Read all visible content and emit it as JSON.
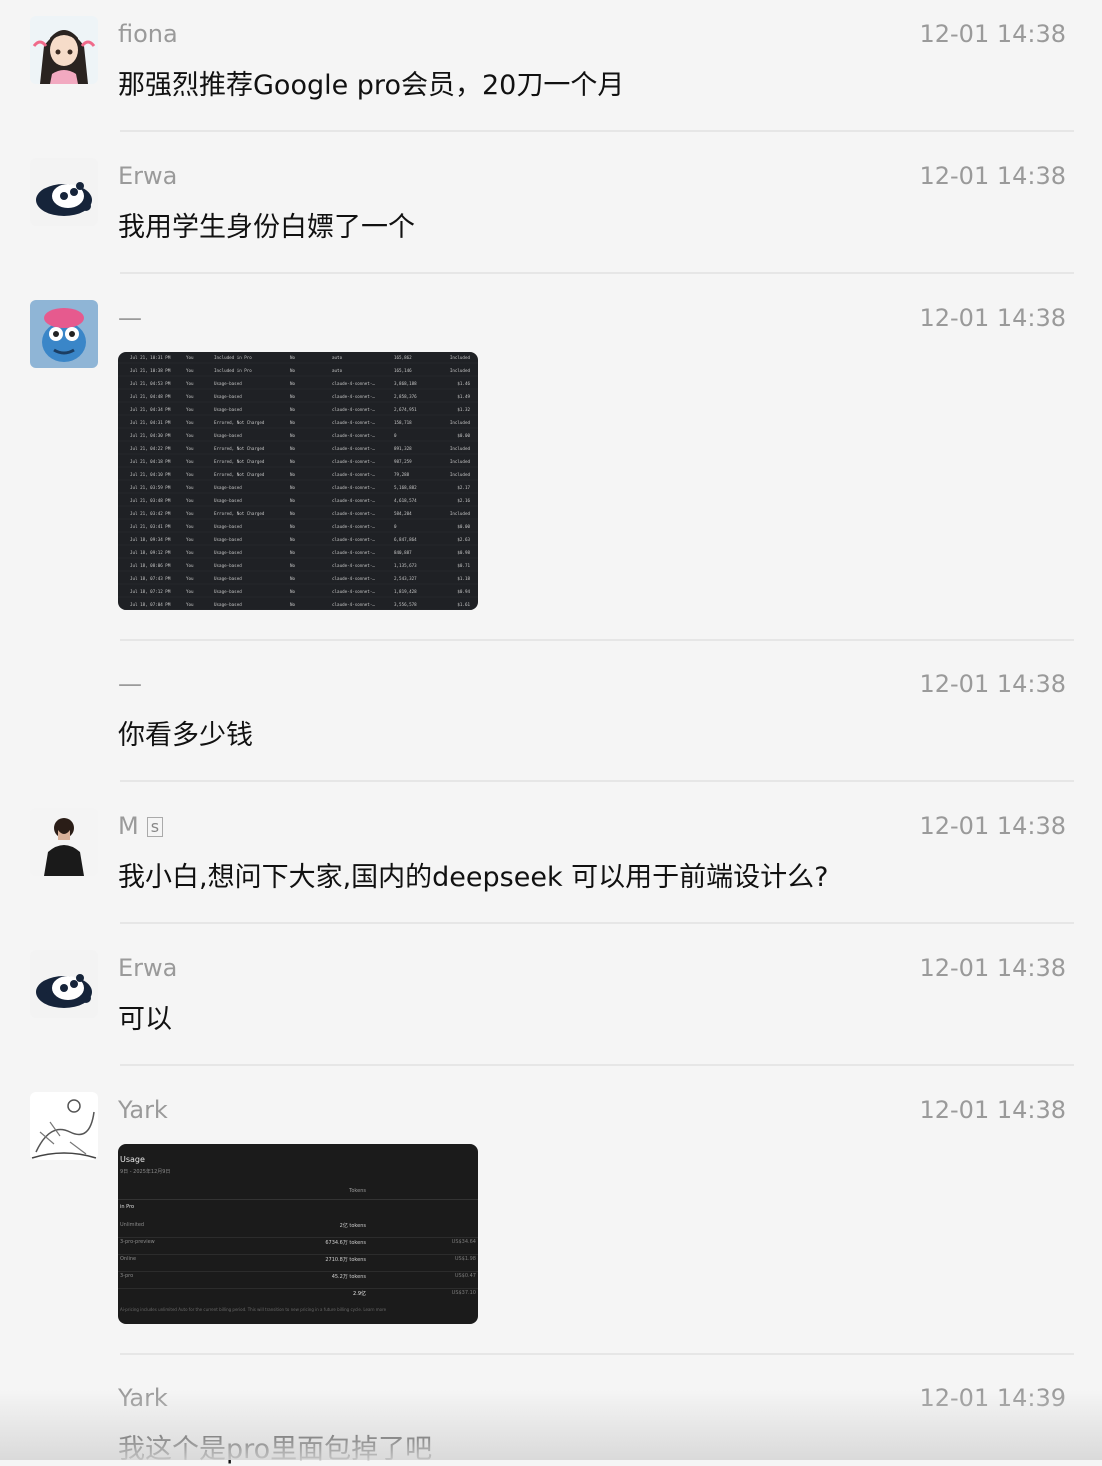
{
  "messages": [
    {
      "name": "fiona",
      "time": "12-01 14:38",
      "text": "那强烈推荐Google pro会员，20刀一个月"
    },
    {
      "name": "Erwa",
      "time": "12-01 14:38",
      "text": "我用学生身份白嫖了一个"
    },
    {
      "name": "—",
      "time": "12-01 14:38"
    },
    {
      "name": "—",
      "time": "12-01 14:38",
      "text": "你看多少钱"
    },
    {
      "name": "M",
      "badge": "s",
      "time": "12-01 14:38",
      "text": "我小白,想问下大家,国内的deepseek 可以用于前端设计么?"
    },
    {
      "name": "Erwa",
      "time": "12-01 14:38",
      "text": "可以"
    },
    {
      "name": "Yark",
      "time": "12-01 14:38"
    },
    {
      "name": "Yark",
      "time": "12-01 14:39",
      "text": "我这个是pro里面包掉了吧"
    }
  ],
  "usage_table_rows": [
    [
      "Jul 21, 10:31 PM",
      "You",
      "Included in Pro",
      "No",
      "auto",
      "165,862",
      "Included"
    ],
    [
      "Jul 21, 10:38 PM",
      "You",
      "Included in Pro",
      "No",
      "auto",
      "165,146",
      "Included"
    ],
    [
      "Jul 21, 04:53 PM",
      "You",
      "Usage-based",
      "No",
      "claude-4-sonnet-…",
      "3,868,188",
      "$1.46"
    ],
    [
      "Jul 21, 04:48 PM",
      "You",
      "Usage-based",
      "No",
      "claude-4-sonnet-…",
      "2,858,376",
      "$1.49"
    ],
    [
      "Jul 21, 04:34 PM",
      "You",
      "Usage-based",
      "No",
      "claude-4-sonnet-…",
      "2,674,951",
      "$1.32"
    ],
    [
      "Jul 21, 04:31 PM",
      "You",
      "Errored, Not Charged",
      "No",
      "claude-4-sonnet-…",
      "158,718",
      "Included"
    ],
    [
      "Jul 21, 04:30 PM",
      "You",
      "Usage-based",
      "No",
      "claude-4-sonnet-…",
      "0",
      "$0.00"
    ],
    [
      "Jul 21, 04:22 PM",
      "You",
      "Errored, Not Charged",
      "No",
      "claude-4-sonnet-…",
      "891,328",
      "Included"
    ],
    [
      "Jul 21, 04:18 PM",
      "You",
      "Errored, Not Charged",
      "No",
      "claude-4-sonnet-…",
      "987,259",
      "Included"
    ],
    [
      "Jul 21, 04:10 PM",
      "You",
      "Errored, Not Charged",
      "No",
      "claude-4-sonnet-…",
      "79,288",
      "Included"
    ],
    [
      "Jul 21, 03:59 PM",
      "You",
      "Usage-based",
      "No",
      "claude-4-sonnet-…",
      "5,168,882",
      "$2.17"
    ],
    [
      "Jul 21, 03:48 PM",
      "You",
      "Usage-based",
      "No",
      "claude-4-sonnet-…",
      "4,618,574",
      "$2.16"
    ],
    [
      "Jul 21, 03:42 PM",
      "You",
      "Errored, Not Charged",
      "No",
      "claude-4-sonnet-…",
      "584,204",
      "Included"
    ],
    [
      "Jul 21, 03:41 PM",
      "You",
      "Usage-based",
      "No",
      "claude-4-sonnet-…",
      "0",
      "$0.00"
    ],
    [
      "Jul 18, 09:34 PM",
      "You",
      "Usage-based",
      "No",
      "claude-4-sonnet-…",
      "6,847,864",
      "$2.63"
    ],
    [
      "Jul 18, 09:12 PM",
      "You",
      "Usage-based",
      "No",
      "claude-4-sonnet-…",
      "840,887",
      "$0.98"
    ],
    [
      "Jul 18, 08:06 PM",
      "You",
      "Usage-based",
      "No",
      "claude-4-sonnet-…",
      "1,135,673",
      "$0.71"
    ],
    [
      "Jul 18, 07:43 PM",
      "You",
      "Usage-based",
      "No",
      "claude-4-sonnet-…",
      "2,543,327",
      "$1.18"
    ],
    [
      "Jul 18, 07:12 PM",
      "You",
      "Usage-based",
      "No",
      "claude-4-sonnet-…",
      "1,819,428",
      "$0.94"
    ],
    [
      "Jul 18, 07:04 PM",
      "You",
      "Usage-based",
      "No",
      "claude-4-sonnet-…",
      "3,556,578",
      "$1.61"
    ]
  ],
  "usage_panel": {
    "title": "Usage",
    "subtitle": "9日 - 2025年12月9日",
    "tokens_header": "Tokens",
    "section": "in Pro",
    "rows": [
      {
        "label": "Unlimited",
        "tokens": "2亿 tokens",
        "cost": ""
      },
      {
        "label": "3-pro-preview",
        "tokens": "6734.6万 tokens",
        "cost": "US$34.64"
      },
      {
        "label": "Online",
        "tokens": "2710.8万 tokens",
        "cost": "US$1.98"
      },
      {
        "label": "3-pro",
        "tokens": "45.2万 tokens",
        "cost": "US$0.47"
      },
      {
        "label": "",
        "tokens": "2.9亿",
        "cost": "US$37.10"
      }
    ],
    "footnote": "Ai-pricing includes unlimited Auto for the current billing period. This will transition to new pricing in a future billing cycle. Learn more"
  }
}
